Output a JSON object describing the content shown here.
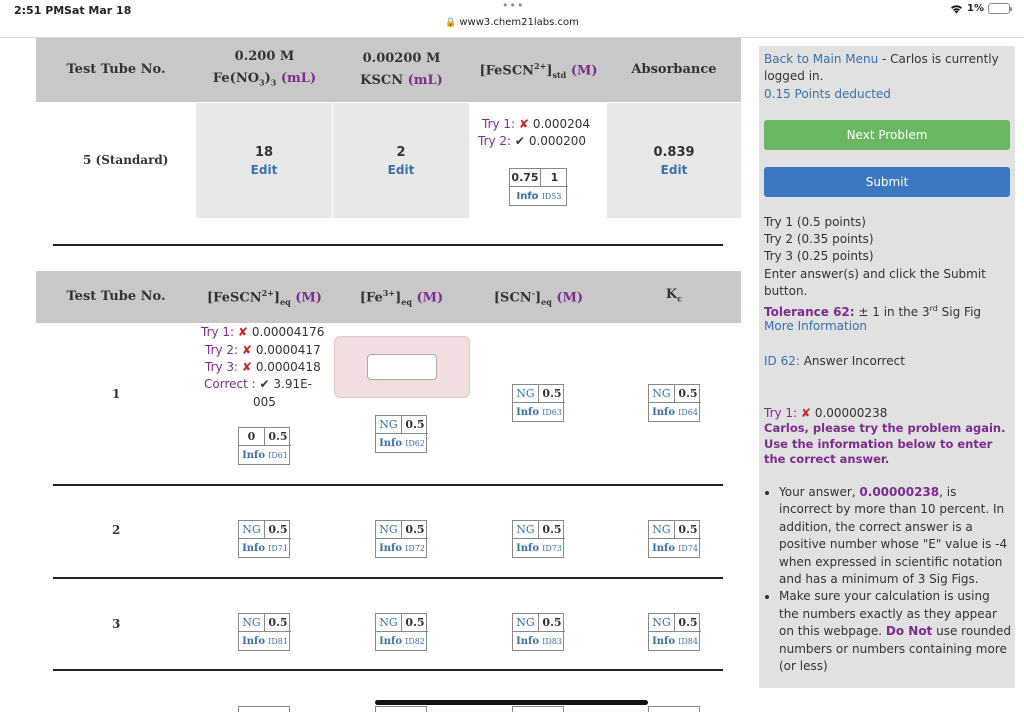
{
  "status": {
    "time": "2:51 PM",
    "date": "Sat Mar 18",
    "url": "www3.chem21labs.com",
    "battery": "1%"
  },
  "table1": {
    "headers": {
      "test_tube": "Test Tube No.",
      "fe_conc": "0.200 M",
      "fe_formula": "Fe(NO",
      "fe_formula2": ")",
      "fe_sub1": "3",
      "fe_sub2": "3",
      "fe_unit": "(mL)",
      "kscn_conc": "0.00200 M",
      "kscn_name": "KSCN",
      "kscn_unit": "(mL)",
      "fescn_pre": "[FeSCN",
      "fescn_sup": "2+",
      "fescn_post": "]",
      "fescn_sub": "std",
      "fescn_unit": "(M)",
      "absorbance": "Absorbance"
    },
    "row": {
      "label": "5 (Standard)",
      "fe_value": "18",
      "fe_edit": "Edit",
      "kscn_value": "2",
      "kscn_edit": "Edit",
      "try1_label": "Try 1:",
      "try1_value": "0.000204",
      "try2_label": "Try 2:",
      "try2_value": "0.000200",
      "score_a": "0.75",
      "score_b": "1",
      "info_label": "Info",
      "info_id": "ID53",
      "abs_value": "0.839",
      "abs_edit": "Edit"
    }
  },
  "table2": {
    "headers": {
      "test_tube": "Test Tube No.",
      "fescn_pre": "[FeSCN",
      "fescn_sup": "2+",
      "fescn_post": "]",
      "fescn_sub": "eq",
      "fe_pre": "[Fe",
      "fe_sup": "3+",
      "fe_post": "]",
      "fe_sub": "eq",
      "scn_pre": "[SCN",
      "scn_sup": "-",
      "scn_post": "]",
      "scn_sub": "eq",
      "unit": "(M)",
      "kc": "K",
      "kc_sub": "c"
    },
    "row1": {
      "label": "1",
      "try1_label": "Try 1:",
      "try1_value": "0.00004176",
      "try2_label": "Try 2:",
      "try2_value": "0.0000417",
      "try3_label": "Try 3:",
      "try3_value": "0.0000418",
      "correct_label": "Correct :",
      "correct_value": "3.91E-",
      "correct_value2": "005",
      "input_value": "",
      "score_box": {
        "a": "0",
        "b": "0.5",
        "info": "Info",
        "id": "ID61"
      },
      "fe_box": {
        "a": "NG",
        "b": "0.5",
        "info": "Info",
        "id": "ID62"
      },
      "scn_box": {
        "a": "NG",
        "b": "0.5",
        "info": "Info",
        "id": "ID63"
      },
      "kc_box": {
        "a": "NG",
        "b": "0.5",
        "info": "Info",
        "id": "ID64"
      }
    },
    "row2": {
      "label": "2",
      "boxes": [
        {
          "a": "NG",
          "b": "0.5",
          "info": "Info",
          "id": "ID71"
        },
        {
          "a": "NG",
          "b": "0.5",
          "info": "Info",
          "id": "ID72"
        },
        {
          "a": "NG",
          "b": "0.5",
          "info": "Info",
          "id": "ID73"
        },
        {
          "a": "NG",
          "b": "0.5",
          "info": "Info",
          "id": "ID74"
        }
      ]
    },
    "row3": {
      "label": "3",
      "boxes": [
        {
          "a": "NG",
          "b": "0.5",
          "info": "Info",
          "id": "ID81"
        },
        {
          "a": "NG",
          "b": "0.5",
          "info": "Info",
          "id": "ID82"
        },
        {
          "a": "NG",
          "b": "0.5",
          "info": "Info",
          "id": "ID83"
        },
        {
          "a": "NG",
          "b": "0.5",
          "info": "Info",
          "id": "ID84"
        }
      ]
    }
  },
  "sidebar": {
    "back_link": "Back to Main Menu",
    "logged_text": " - Carlos is currently logged in.",
    "points_deducted": "0.15 Points deducted",
    "next_button": "Next Problem",
    "submit_button": "Submit",
    "try1_points": "Try 1 (0.5 points)",
    "try2_points": "Try 2 (0.35 points)",
    "try3_points": "Try 3 (0.25 points)",
    "instruction": "Enter answer(s) and click the Submit button.",
    "tolerance_label": "Tolerance 62:",
    "tolerance_pre": " ± 1 in the 3",
    "tolerance_sup": "rd",
    "tolerance_post": " Sig Fig",
    "more_info": "More Information",
    "id_label": "ID 62:",
    "id_status": " Answer Incorrect",
    "try1_label": "Try 1:",
    "try1_value": "0.00000238",
    "feedback": "Carlos, please try the problem again. Use the information below to enter the correct answer.",
    "bullet1_pre": "Your answer, ",
    "bullet1_value": "0.00000238",
    "bullet1_post": ", is incorrect by more than 10 percent. In addition, the correct answer is a positive number whose \"E\" value is -4 when expressed in scientific notation and has a minimum of 3 Sig Figs.",
    "bullet2_pre": "Make sure your calculation is using the numbers exactly as they appear on this webpage. ",
    "bullet2_bold": "Do Not",
    "bullet2_post": " use rounded numbers or numbers containing more (or less)"
  },
  "colors": {
    "header_bg": "#c8c8c8",
    "unit_purple": "#7b2d8e",
    "link_blue": "#3a6fb0",
    "error_red": "#c0282b",
    "next_green": "#6ab663",
    "submit_blue": "#3b78c2"
  },
  "icons": [
    "lock-icon",
    "wifi-icon",
    "battery-icon",
    "x-mark-icon",
    "check-mark-icon"
  ]
}
